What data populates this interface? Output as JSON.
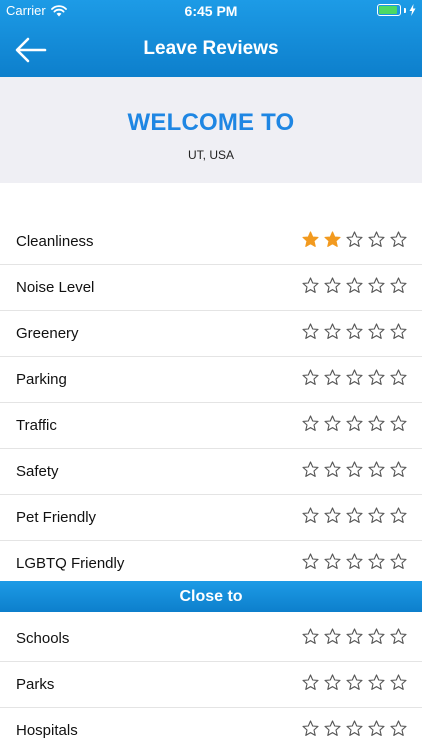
{
  "status_bar": {
    "carrier": "Carrier",
    "time": "6:45 PM",
    "battery_level": 0.9
  },
  "nav": {
    "title": "Leave Reviews",
    "back_icon": "arrow-left-icon"
  },
  "welcome": {
    "title": "WELCOME TO",
    "location": "UT, USA"
  },
  "colors": {
    "accent": "#1e86e3",
    "header_gradient_top": "#1d9be6",
    "header_gradient_bottom": "#0d7fcc",
    "star_filled": "#f29a1f",
    "star_empty_outline": "#555555"
  },
  "max_stars": 5,
  "ratings": [
    {
      "label": "Cleanliness",
      "value": 2
    },
    {
      "label": "Noise Level",
      "value": 0
    },
    {
      "label": "Greenery",
      "value": 0
    },
    {
      "label": "Parking",
      "value": 0
    },
    {
      "label": "Traffic",
      "value": 0
    },
    {
      "label": "Safety",
      "value": 0
    },
    {
      "label": "Pet Friendly",
      "value": 0
    },
    {
      "label": "LGBTQ Friendly",
      "value": 0
    }
  ],
  "close_to": {
    "header": "Close to",
    "items": [
      {
        "label": "Schools",
        "value": 0
      },
      {
        "label": "Parks",
        "value": 0
      },
      {
        "label": "Hospitals",
        "value": 0
      }
    ]
  }
}
